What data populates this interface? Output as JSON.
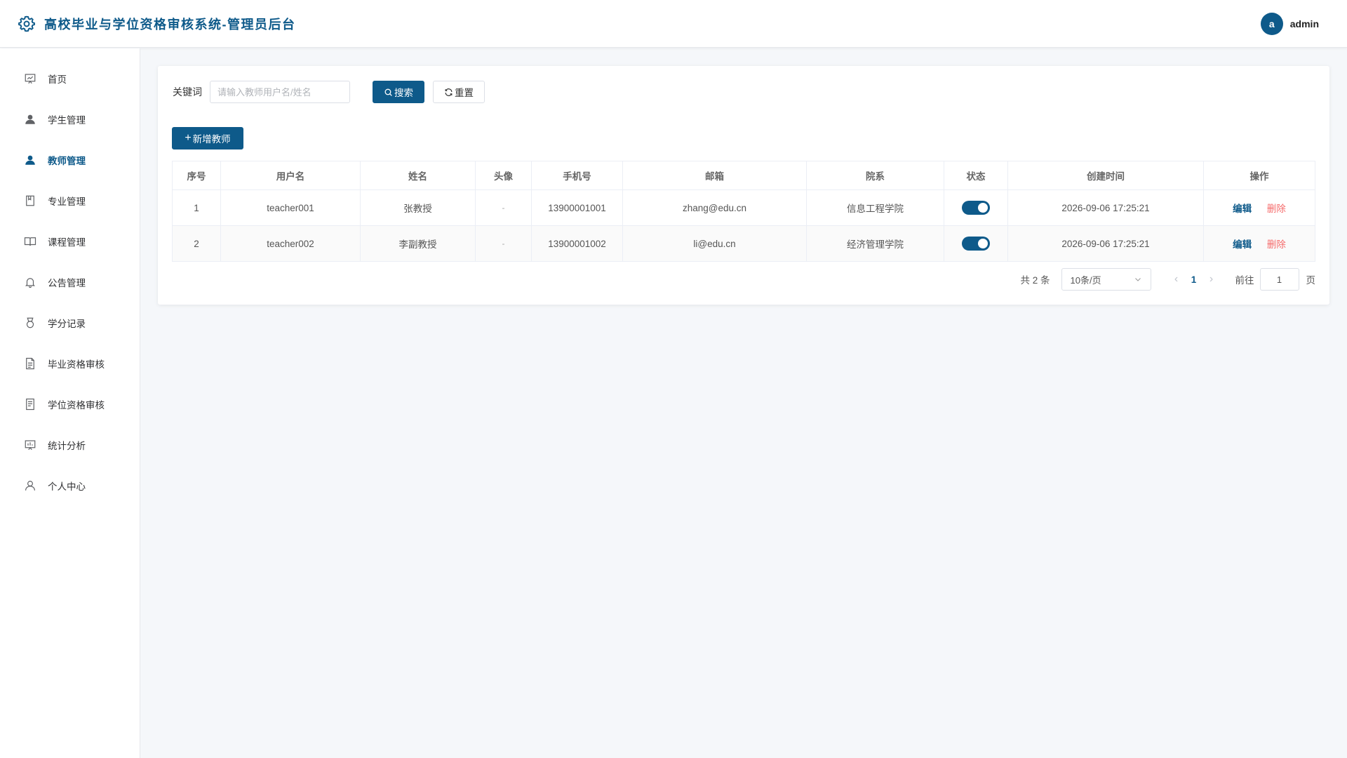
{
  "header": {
    "title": "高校毕业与学位资格审核系统-管理员后台",
    "avatar_letter": "a",
    "username": "admin"
  },
  "sidebar": {
    "items": [
      {
        "label": "首页",
        "icon": "chart-board-icon"
      },
      {
        "label": "学生管理",
        "icon": "user-filled-icon"
      },
      {
        "label": "教师管理",
        "icon": "user-filled-icon",
        "active": true
      },
      {
        "label": "专业管理",
        "icon": "notebook-icon"
      },
      {
        "label": "课程管理",
        "icon": "book-open-icon"
      },
      {
        "label": "公告管理",
        "icon": "bell-icon"
      },
      {
        "label": "学分记录",
        "icon": "medal-icon"
      },
      {
        "label": "毕业资格审核",
        "icon": "document-icon"
      },
      {
        "label": "学位资格审核",
        "icon": "tickets-icon"
      },
      {
        "label": "统计分析",
        "icon": "data-board-icon"
      },
      {
        "label": "个人中心",
        "icon": "user-outline-icon"
      }
    ]
  },
  "filter": {
    "label": "关键词",
    "placeholder": "请输入教师用户名/姓名",
    "search_label": "搜索",
    "reset_label": "重置"
  },
  "toolbar": {
    "add_label": "新增教师"
  },
  "table": {
    "columns": [
      "序号",
      "用户名",
      "姓名",
      "头像",
      "手机号",
      "邮箱",
      "院系",
      "状态",
      "创建时间",
      "操作"
    ],
    "rows": [
      {
        "index": "1",
        "username": "teacher001",
        "name": "张教授",
        "avatar": "-",
        "phone": "13900001001",
        "email": "zhang@edu.cn",
        "dept": "信息工程学院",
        "status": true,
        "created": "2026-09-06 17:25:21"
      },
      {
        "index": "2",
        "username": "teacher002",
        "name": "李副教授",
        "avatar": "-",
        "phone": "13900001002",
        "email": "li@edu.cn",
        "dept": "经济管理学院",
        "status": true,
        "created": "2026-09-06 17:25:21"
      }
    ],
    "edit_label": "编辑",
    "delete_label": "删除"
  },
  "pagination": {
    "total_text": "共 2 条",
    "page_size": "10条/页",
    "current_page": "1",
    "goto_label": "前往",
    "goto_value": "1",
    "goto_suffix": "页"
  },
  "colors": {
    "primary": "#0e5a8a",
    "danger": "#f56c6c"
  }
}
